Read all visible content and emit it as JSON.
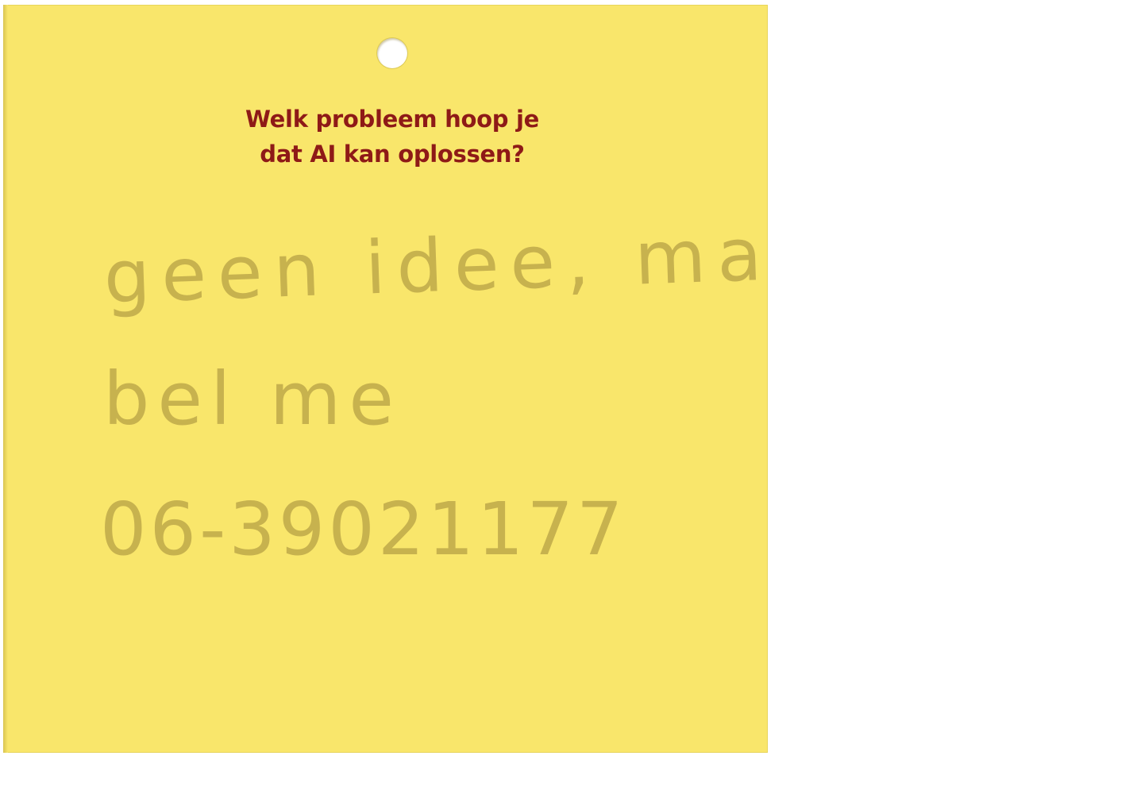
{
  "card": {
    "question_line1": "Welk probleem hoop je",
    "question_line2": "dat AI kan oplossen?",
    "answer_line1": "geen idee, maar",
    "answer_line2": "bel me",
    "answer_line3": "06-39021177"
  },
  "colors": {
    "card_background": "#f9e66b",
    "question_text": "#8e1a17",
    "handwriting_ink": "#bfa94a"
  }
}
